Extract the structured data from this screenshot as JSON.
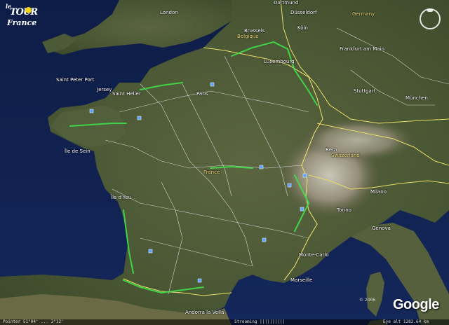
{
  "app": {
    "brand_logo_text": "le Tour de France",
    "provider_logo": "Google"
  },
  "colors": {
    "sea": "#12224f",
    "land": "#4c5a36",
    "route": "#3fe04a",
    "border_country": "#e8dd6a",
    "border_region": "#f2f2f2"
  },
  "labels": {
    "london": "London",
    "saint_peter_port": "Saint Peter Port",
    "jersey": "Jersey",
    "saint_helier": "Saint Helier",
    "paris": "Paris",
    "brussels": "Brussels",
    "belgique": "Belgique",
    "luxembourg": "Luxembourg",
    "dortmund": "Dortmund",
    "dusseldorf": "Düsseldorf",
    "koln": "Köln",
    "germany": "Germany",
    "frankfurt": "Frankfurt am Main",
    "stuttgart": "Stuttgart",
    "munchen": "München",
    "bern": "Bern",
    "switzerland": "Switzerland",
    "france": "France",
    "milano": "Milano",
    "torino": "Torino",
    "genova": "Genova",
    "monte_carlo": "Monte-Carlo",
    "marseille": "Marseille",
    "andorra": "Andorra la Vella",
    "ile_de_sein": "Île de Sein",
    "ile_d_yeu": "Île d'Yeu"
  },
  "footer": {
    "copyright": "© 2006",
    "pointer": "Pointer 51°04' ... 3°12'",
    "streaming": "Streaming ||||||||||",
    "eye_alt": "Eye alt  1282.64 km"
  },
  "compass": {
    "icon": "compass-icon"
  }
}
